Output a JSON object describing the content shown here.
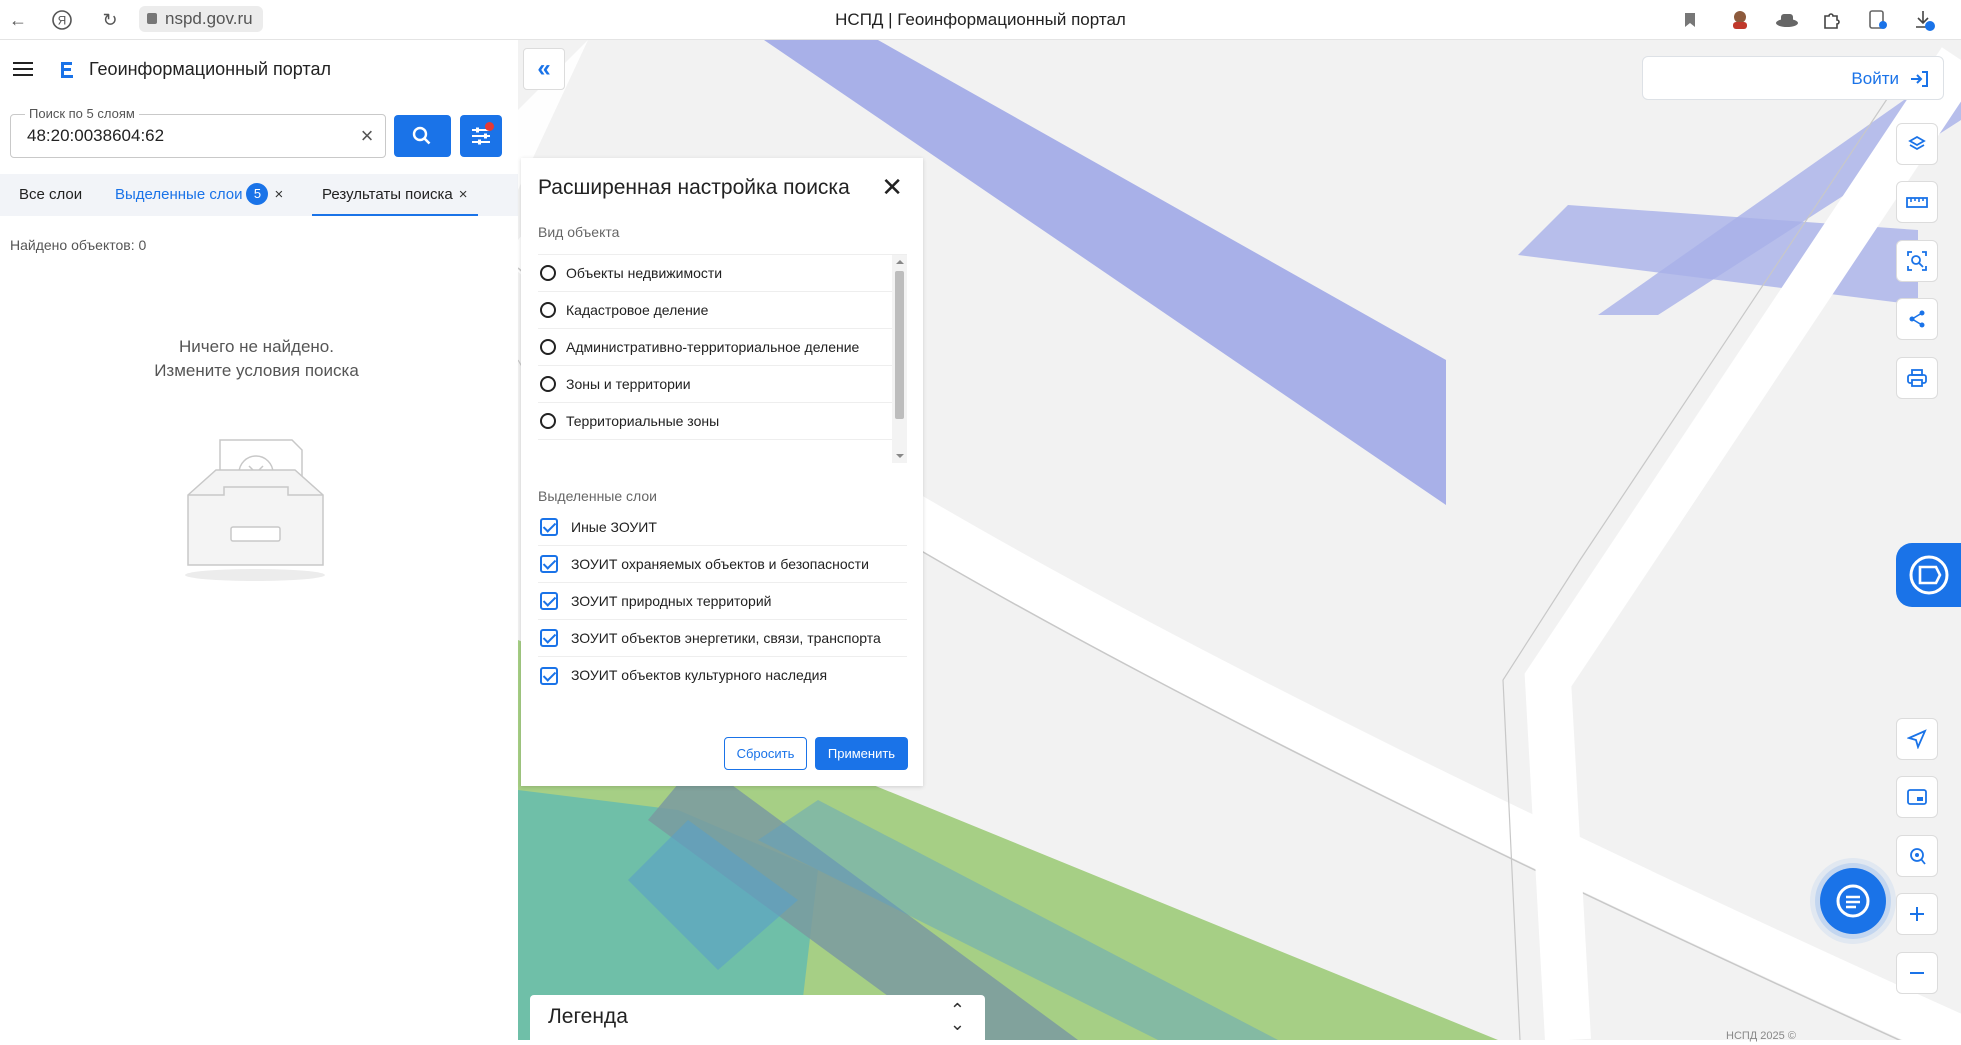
{
  "browser": {
    "url": "nspd.gov.ru",
    "tab_title": "НСПД | Геоинформационный портал"
  },
  "sidebar": {
    "app_title": "Геоинформационный портал",
    "search": {
      "label": "Поиск по 5 слоям",
      "value": "48:20:0038604:62"
    },
    "tabs": [
      {
        "label": "Все слои"
      },
      {
        "label": "Выделенные слои",
        "badge": "5",
        "close": "×"
      },
      {
        "label": "Результаты поиска",
        "close": "×"
      }
    ],
    "found_text": "Найдено объектов: 0",
    "empty_line1": "Ничего не найдено.",
    "empty_line2": "Измените условия поиска"
  },
  "map": {
    "login_label": "Войти",
    "legend_label": "Легенда",
    "attribution": "НСПД 2025 ©"
  },
  "dialog": {
    "title": "Расширенная настройка поиска",
    "object_type_label": "Вид объекта",
    "object_types": [
      "Объекты недвижимости",
      "Кадастровое деление",
      "Административно-территориальное деление",
      "Зоны и территории",
      "Территориальные зоны"
    ],
    "selected_layers_label": "Выделенные слои",
    "selected_layers": [
      "Иные ЗОУИТ",
      "ЗОУИТ охраняемых объектов и безопасности",
      "ЗОУИТ природных территорий",
      "ЗОУИТ объектов энергетики, связи, транспорта",
      "ЗОУИТ объектов культурного наследия"
    ],
    "reset_label": "Сбросить",
    "apply_label": "Применить"
  },
  "colors": {
    "accent": "#1a73e8",
    "zone_purple": "#a8b0e8",
    "zone_green": "#a6cf85",
    "zone_teal": "#6fbfa8"
  }
}
